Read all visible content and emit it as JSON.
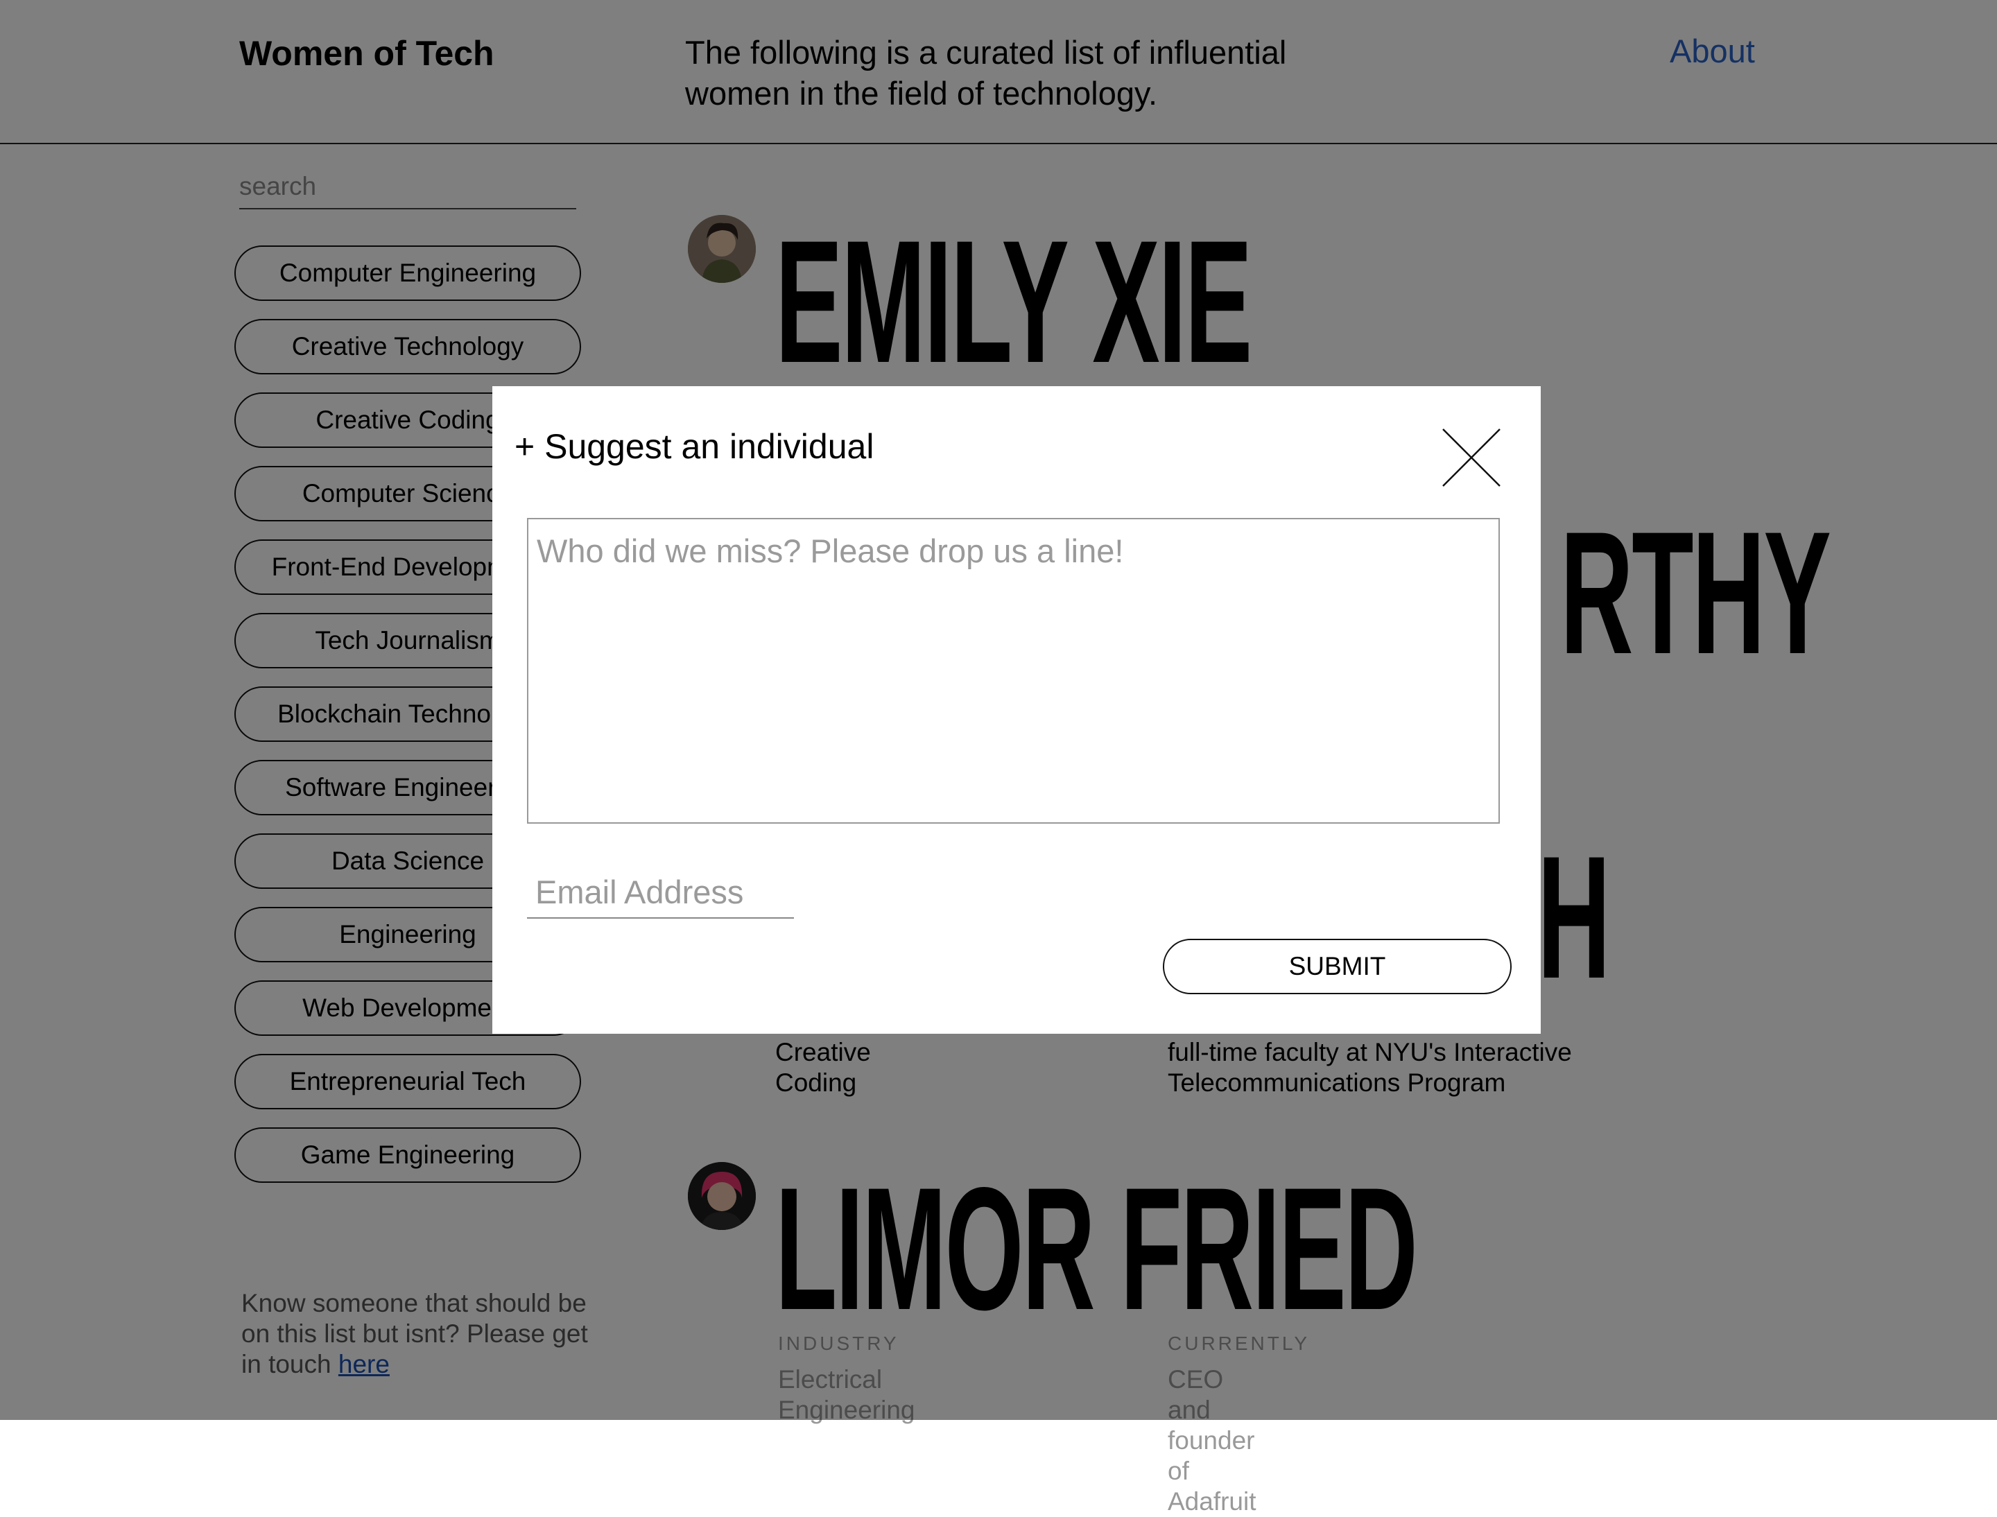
{
  "header": {
    "brand": "Women of Tech",
    "intro": "The following is a curated list of influential women in the field of technology.",
    "about_link": "About"
  },
  "sidebar": {
    "search_placeholder": "search",
    "filters": [
      "Computer Engineering",
      "Creative Technology",
      "Creative Coding",
      "Computer Science",
      "Front-End Development",
      "Tech Journalism",
      "Blockchain Technology",
      "Software Engineering",
      "Data Science",
      "Engineering",
      "Web Development",
      "Entrepreneurial Tech",
      "Game Engineering"
    ],
    "note_text": "Know someone that should be on this list but isnt? Please get in touch ",
    "note_link": "here"
  },
  "entries": {
    "e1": {
      "name": "EMILY XIE"
    },
    "e2": {
      "name_tail": "RTHY"
    },
    "e3": {
      "name_tail": "SH",
      "industry": "Creative Coding",
      "currently": "full-time faculty at NYU's Interactive Telecommunications Program"
    },
    "e4": {
      "name": "LIMOR FRIED",
      "industry_label": "INDUSTRY",
      "currently_label": "CURRENTLY",
      "industry": "Electrical Engineering",
      "currently": "CEO and founder of Adafruit"
    }
  },
  "modal": {
    "title": "+ Suggest an individual",
    "message_placeholder": "Who did we miss? Please drop us a line!",
    "email_placeholder": "Email Address",
    "submit_label": "SUBMIT"
  }
}
